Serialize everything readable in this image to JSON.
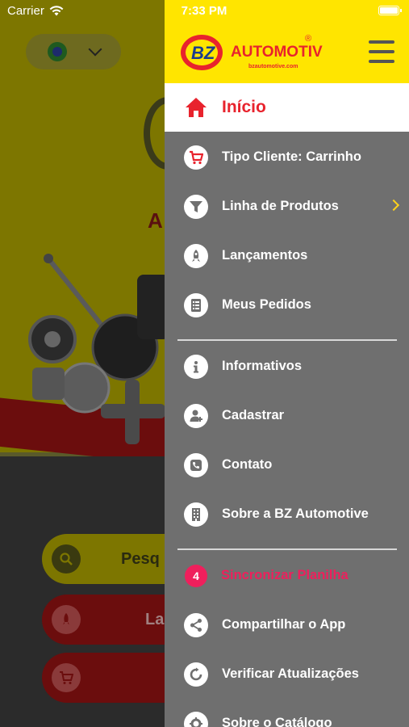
{
  "status_bar": {
    "carrier": "Carrier",
    "time": "7:33 PM"
  },
  "brand": {
    "logo_letters": "BZ",
    "name": "AUTOMOTIVE",
    "registered": "®",
    "site": "bzautomotive.com"
  },
  "background": {
    "logo_fragment": "A",
    "search_button": "Pesq",
    "launch_button": "La"
  },
  "menu": {
    "home": "Início",
    "items": [
      {
        "label": "Tipo Cliente: Carrinho",
        "icon": "cart-icon"
      },
      {
        "label": "Linha de Produtos",
        "icon": "filter-icon",
        "has_submenu": true
      },
      {
        "label": "Lançamentos",
        "icon": "rocket-icon"
      },
      {
        "label": "Meus Pedidos",
        "icon": "document-list-icon"
      },
      {
        "label": "Informativos",
        "icon": "info-icon"
      },
      {
        "label": "Cadastrar",
        "icon": "add-user-icon"
      },
      {
        "label": "Contato",
        "icon": "phone-icon"
      },
      {
        "label": "Sobre a BZ Automotive",
        "icon": "building-icon"
      },
      {
        "label": "Sincronizar Planilha",
        "badge": "4"
      },
      {
        "label": "Compartilhar o App",
        "icon": "share-icon"
      },
      {
        "label": "Verificar Atualizações",
        "icon": "refresh-icon"
      },
      {
        "label": "Sobre o Catálogo",
        "icon": "gear-icon"
      }
    ]
  },
  "colors": {
    "header_yellow": "#ffe500",
    "home_red": "#e8232d",
    "drawer_gray": "#6f6f6f",
    "badge_pink": "#ef1f5c",
    "chevron_yellow": "#ffd21a"
  }
}
